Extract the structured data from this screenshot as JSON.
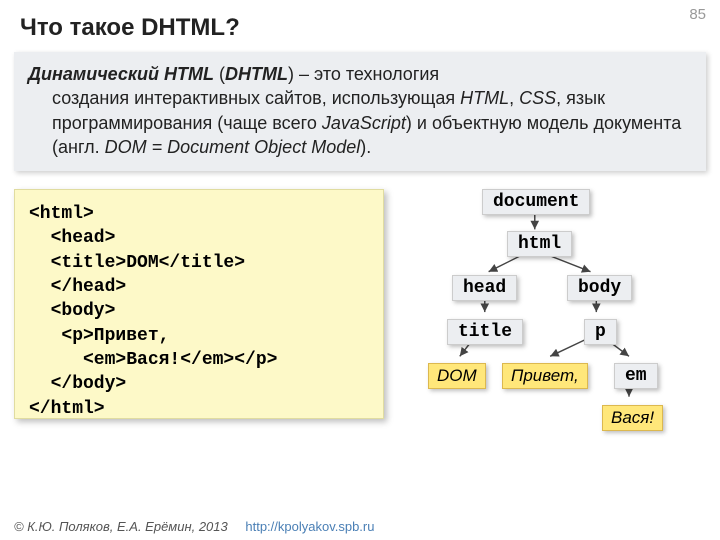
{
  "page_number": "85",
  "title": "Что такое DHTML?",
  "desc": {
    "lead_b": "Динамический HTML",
    "lead_paren": "DHTML",
    "rest1": " – это технология",
    "rest2": "создания интерактивных сайтов, использующая ",
    "i1": "HTML",
    "comma1": ", ",
    "i2": "CSS",
    "rest3": ", язык программирования (чаще всего ",
    "i3": "JavaScript",
    "rest4": ") и объектную модель документа (англ. ",
    "i4": "DOM = Document Object Model",
    "rest5": ")."
  },
  "code": "<html>\n  <head>\n  <title>DOM</title>\n  </head>\n  <body>\n   <p>Привет,\n     <em>Вася!</em></p>\n  </body>\n</html>",
  "tree": {
    "document": "document",
    "html": "html",
    "head": "head",
    "body": "body",
    "title": "title",
    "p": "p",
    "dom": "DOM",
    "hello": "Привет,",
    "em": "em",
    "vasya": "Вася!"
  },
  "footer": {
    "copy": "© К.Ю. Поляков, Е.А. Ерёмин, 2013",
    "url": "http://kpolyakov.spb.ru"
  }
}
